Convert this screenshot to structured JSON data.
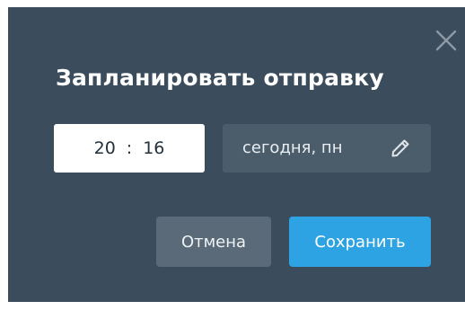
{
  "dialog": {
    "title": "Запланировать отправку",
    "time": {
      "hours": "20",
      "separator": ":",
      "minutes": "16"
    },
    "date": {
      "label": "сегодня, пн"
    },
    "buttons": {
      "cancel": "Отмена",
      "save": "Сохранить"
    },
    "icons": {
      "close": "close-icon",
      "edit": "pencil-icon"
    }
  },
  "colors": {
    "dialog_bg": "#3b4c5c",
    "date_field_bg": "#4b5c6b",
    "cancel_bg": "#5a6a78",
    "save_bg": "#2ea3e4",
    "time_text": "#23313d"
  }
}
